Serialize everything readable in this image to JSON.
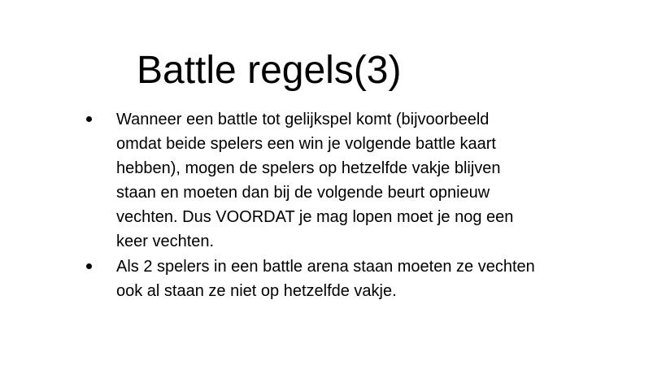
{
  "slide": {
    "title": "Battle regels(3)",
    "bullets": [
      {
        "lines": [
          "Wanneer een battle tot gelijkspel komt (bijvoorbeeld",
          "omdat beide spelers een win je volgende battle kaart",
          "hebben), mogen de spelers op hetzelfde vakje blijven",
          "staan en moeten dan bij de volgende beurt opnieuw",
          "vechten. Dus VOORDAT je mag lopen moet je nog een",
          "keer vechten."
        ]
      },
      {
        "lines": [
          "Als 2 spelers in een battle arena staan moeten ze vechten",
          "ook al staan ze niet op hetzelfde vakje."
        ]
      }
    ]
  }
}
